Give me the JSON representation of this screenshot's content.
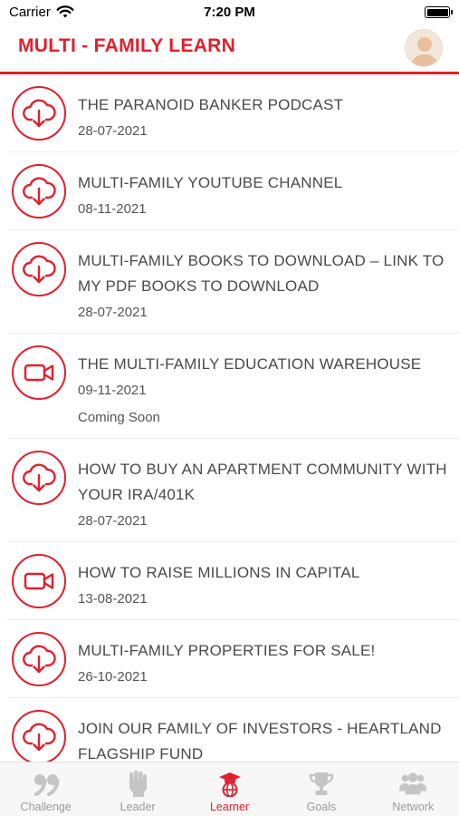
{
  "status_bar": {
    "carrier": "Carrier",
    "time": "7:20 PM"
  },
  "header": {
    "title": "MULTI - FAMILY LEARN"
  },
  "colors": {
    "accent": "#e0202e",
    "inactive": "#c5c5c5"
  },
  "items": [
    {
      "icon": "cloud-download-icon",
      "title": "THE PARANOID BANKER PODCAST",
      "date": "28-07-2021",
      "note": ""
    },
    {
      "icon": "cloud-download-icon",
      "title": "MULTI-FAMILY YOUTUBE CHANNEL",
      "date": "08-11-2021",
      "note": ""
    },
    {
      "icon": "cloud-download-icon",
      "title": "MULTI-FAMILY BOOKS TO DOWNLOAD – LINK TO MY PDF BOOKS TO DOWNLOAD",
      "date": "28-07-2021",
      "note": ""
    },
    {
      "icon": "video-camera-icon",
      "title": "THE MULTI-FAMILY EDUCATION WAREHOUSE",
      "date": "09-11-2021",
      "note": "Coming Soon"
    },
    {
      "icon": "cloud-download-icon",
      "title": "HOW TO BUY AN APARTMENT COMMUNITY WITH YOUR IRA/401K",
      "date": "28-07-2021",
      "note": ""
    },
    {
      "icon": "video-camera-icon",
      "title": "HOW TO RAISE MILLIONS IN CAPITAL",
      "date": "13-08-2021",
      "note": ""
    },
    {
      "icon": "cloud-download-icon",
      "title": "MULTI-FAMILY PROPERTIES FOR SALE!",
      "date": "26-10-2021",
      "note": ""
    },
    {
      "icon": "cloud-download-icon",
      "title": "JOIN OUR FAMILY OF INVESTORS - HEARTLAND FLAGSHIP FUND",
      "date": "",
      "note": ""
    }
  ],
  "tabs": [
    {
      "label": "Challenge",
      "icon": "quote-99-icon",
      "active": false
    },
    {
      "label": "Leader",
      "icon": "raised-fist-icon",
      "active": false
    },
    {
      "label": "Learner",
      "icon": "graduation-globe-icon",
      "active": true
    },
    {
      "label": "Goals",
      "icon": "trophy-icon",
      "active": false
    },
    {
      "label": "Network",
      "icon": "people-group-icon",
      "active": false
    }
  ]
}
